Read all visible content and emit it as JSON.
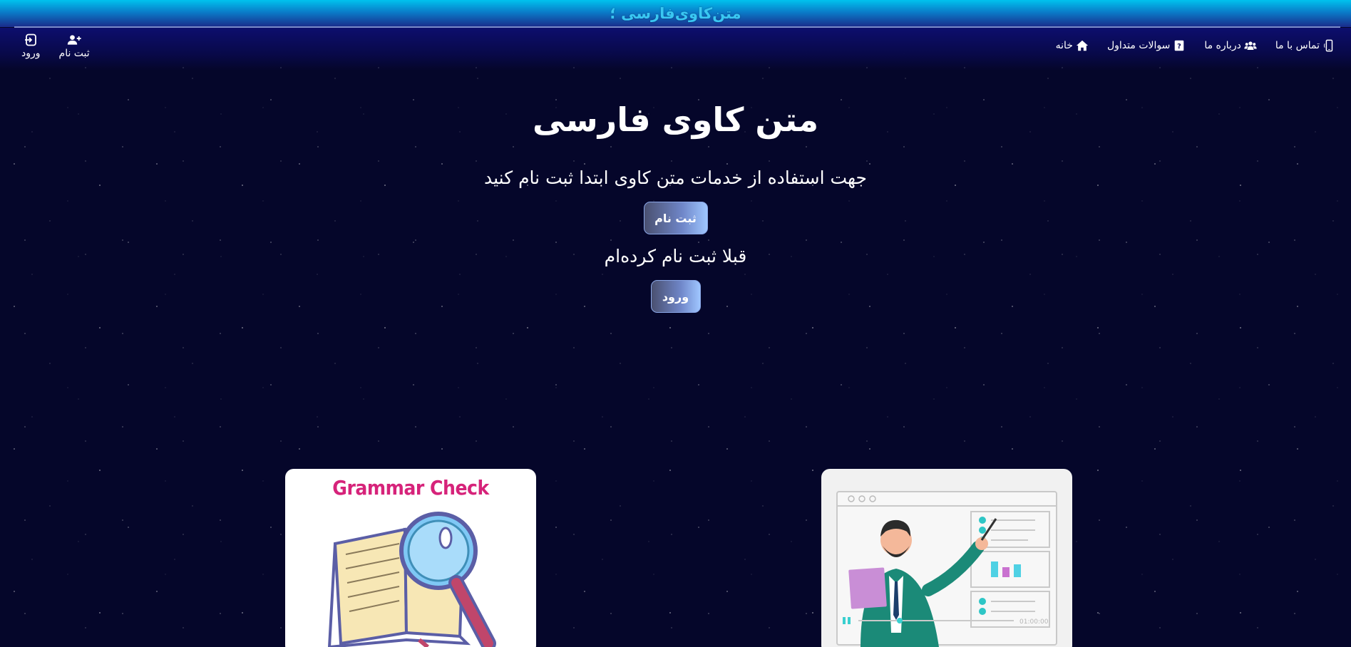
{
  "brand": {
    "name": "متن‌کاوی‌فارسی ؛"
  },
  "nav": {
    "items": [
      {
        "label": "خانه",
        "icon": "home-icon"
      },
      {
        "label": "سوالات متداول",
        "icon": "question-book-icon"
      },
      {
        "label": "درباره ما",
        "icon": "users-icon"
      },
      {
        "label": "تماس با ما",
        "icon": "phone-icon"
      }
    ],
    "register_label": "ثبت نام",
    "login_label": "ورود"
  },
  "hero": {
    "title": "متن کاوی فارسی",
    "subtitle": "جهت استفاده از خدمات متن کاوی ابتدا ثبت نام کنید",
    "register_button": "ثبت نام",
    "already_registered": "قبلا ثبت نام کرده‌ام",
    "login_button": "ورود"
  },
  "cards": [
    {
      "title": "Grammar Check",
      "image": "book-magnifier-illustration"
    },
    {
      "image": "presenter-illustration",
      "video_time": "01:00:00"
    }
  ],
  "colors": {
    "banner_top": "#00c2ee",
    "brand_text": "#39c7f2",
    "background": "#05062a",
    "grammar_title": "#d6237a"
  }
}
